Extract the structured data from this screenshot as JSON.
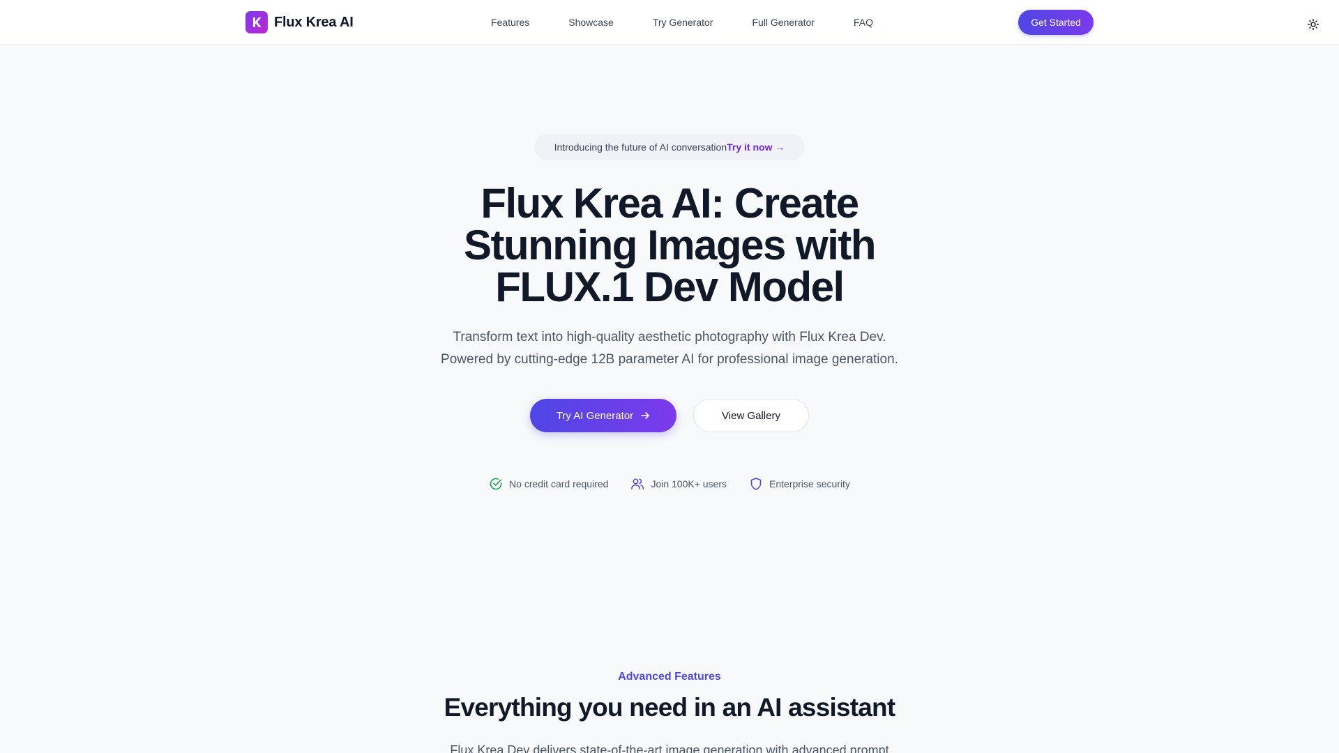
{
  "header": {
    "brand_name": "Flux Krea AI",
    "nav": [
      "Features",
      "Showcase",
      "Try Generator",
      "Full Generator",
      "FAQ"
    ],
    "cta_label": "Get Started",
    "theme_icon": "sun-icon"
  },
  "hero": {
    "pill_text": "Introducing the future of AI conversation",
    "pill_link": "Try it now →",
    "title_line1": "Flux Krea AI: Create",
    "title_line2": "Stunning Images with",
    "title_line3": "FLUX.1 Dev Model",
    "subtitle_line1": "Transform text into high-quality aesthetic photography with Flux Krea Dev.",
    "subtitle_line2": "Powered by cutting-edge 12B parameter AI for professional image generation.",
    "primary_button": "Try AI Generator",
    "secondary_button": "View Gallery",
    "trust": [
      {
        "icon": "check-circle-icon",
        "label": "No credit card required"
      },
      {
        "icon": "users-icon",
        "label": "Join 100K+ users"
      },
      {
        "icon": "shield-icon",
        "label": "Enterprise security"
      }
    ]
  },
  "features": {
    "eyebrow": "Advanced Features",
    "title": "Everything you need in an AI assistant",
    "text": "Flux Krea Dev delivers state-of-the-art image generation with advanced prompt"
  },
  "colors": {
    "accent": "#4f46e5",
    "accent_end": "#7c3aed",
    "background": "#f8f9fb",
    "text": "#111827"
  }
}
